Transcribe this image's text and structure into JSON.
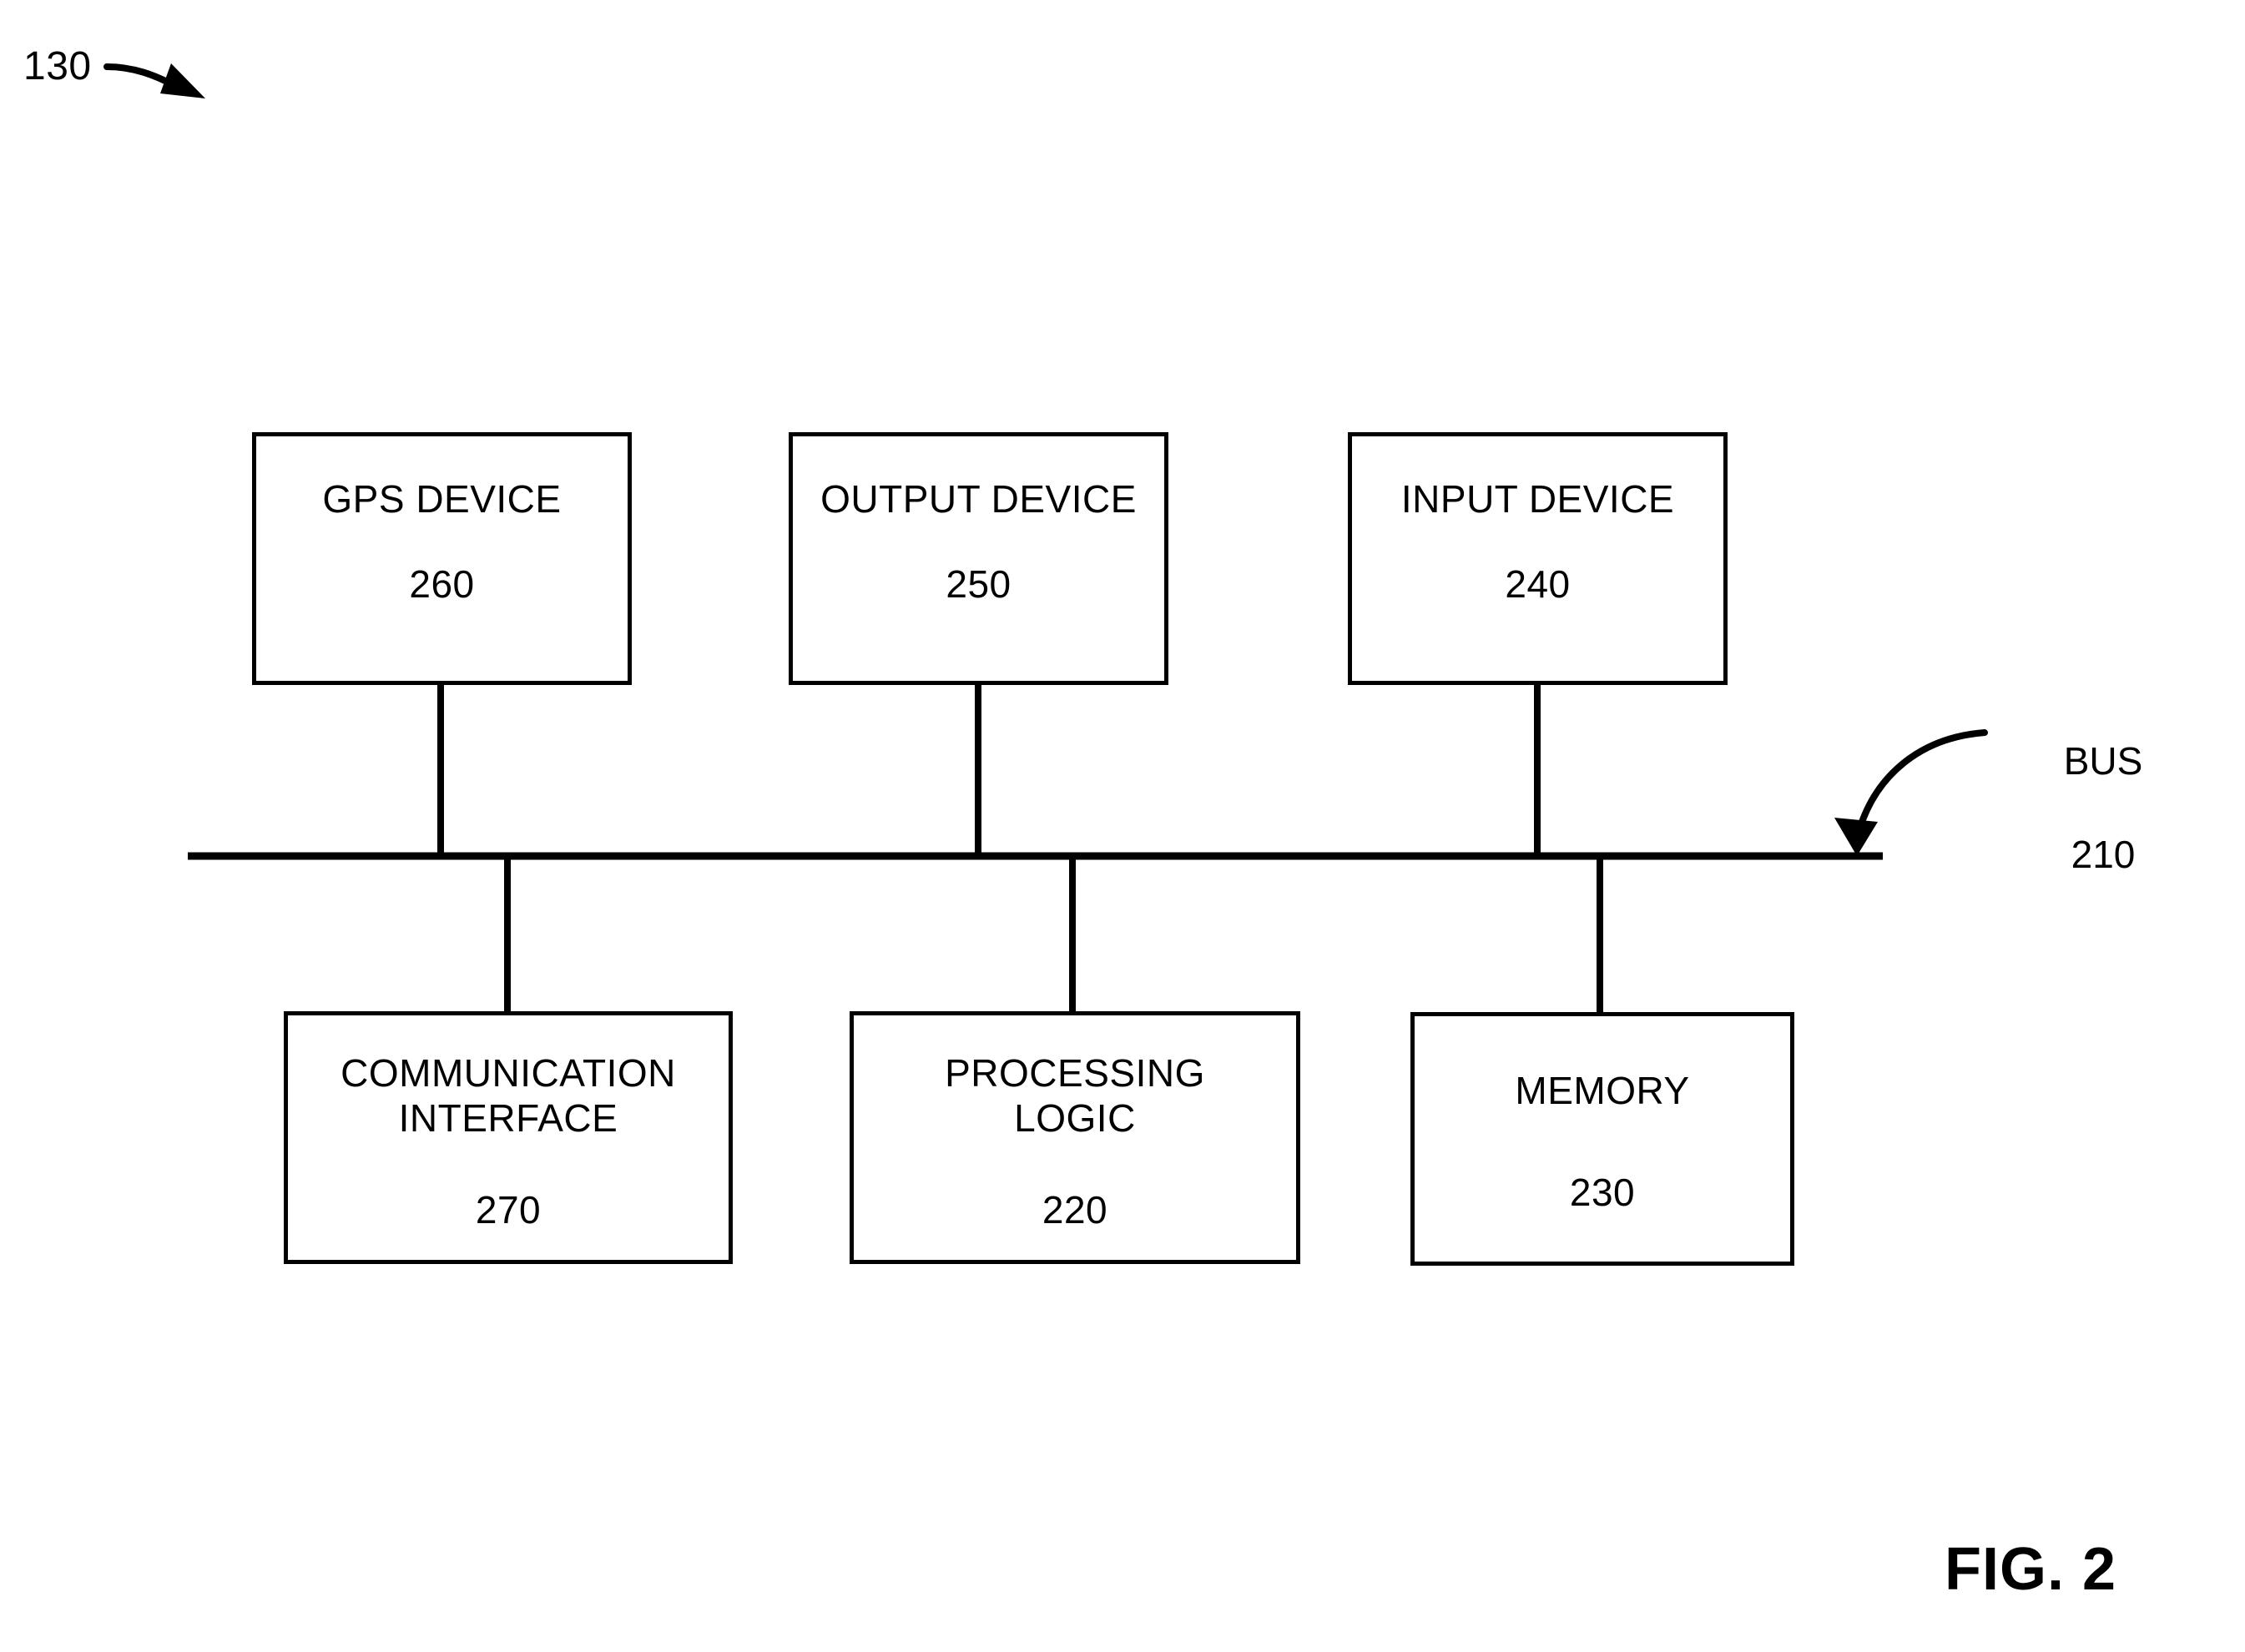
{
  "figure": {
    "caption": "FIG. 2",
    "system_ref": "130"
  },
  "bus": {
    "label": "BUS",
    "ref": "210"
  },
  "nodes": {
    "top": [
      {
        "id": "gps-device",
        "title": "GPS DEVICE",
        "ref": "260"
      },
      {
        "id": "output-device",
        "title": "OUTPUT DEVICE",
        "ref": "250"
      },
      {
        "id": "input-device",
        "title": "INPUT DEVICE",
        "ref": "240"
      }
    ],
    "bottom": [
      {
        "id": "communication-interface",
        "title": "COMMUNICATION\nINTERFACE",
        "ref": "270"
      },
      {
        "id": "processing-logic",
        "title": "PROCESSING\nLOGIC",
        "ref": "220"
      },
      {
        "id": "memory",
        "title": "MEMORY",
        "ref": "230"
      }
    ]
  },
  "style": {
    "line_color": "#000000",
    "background": "#ffffff"
  }
}
